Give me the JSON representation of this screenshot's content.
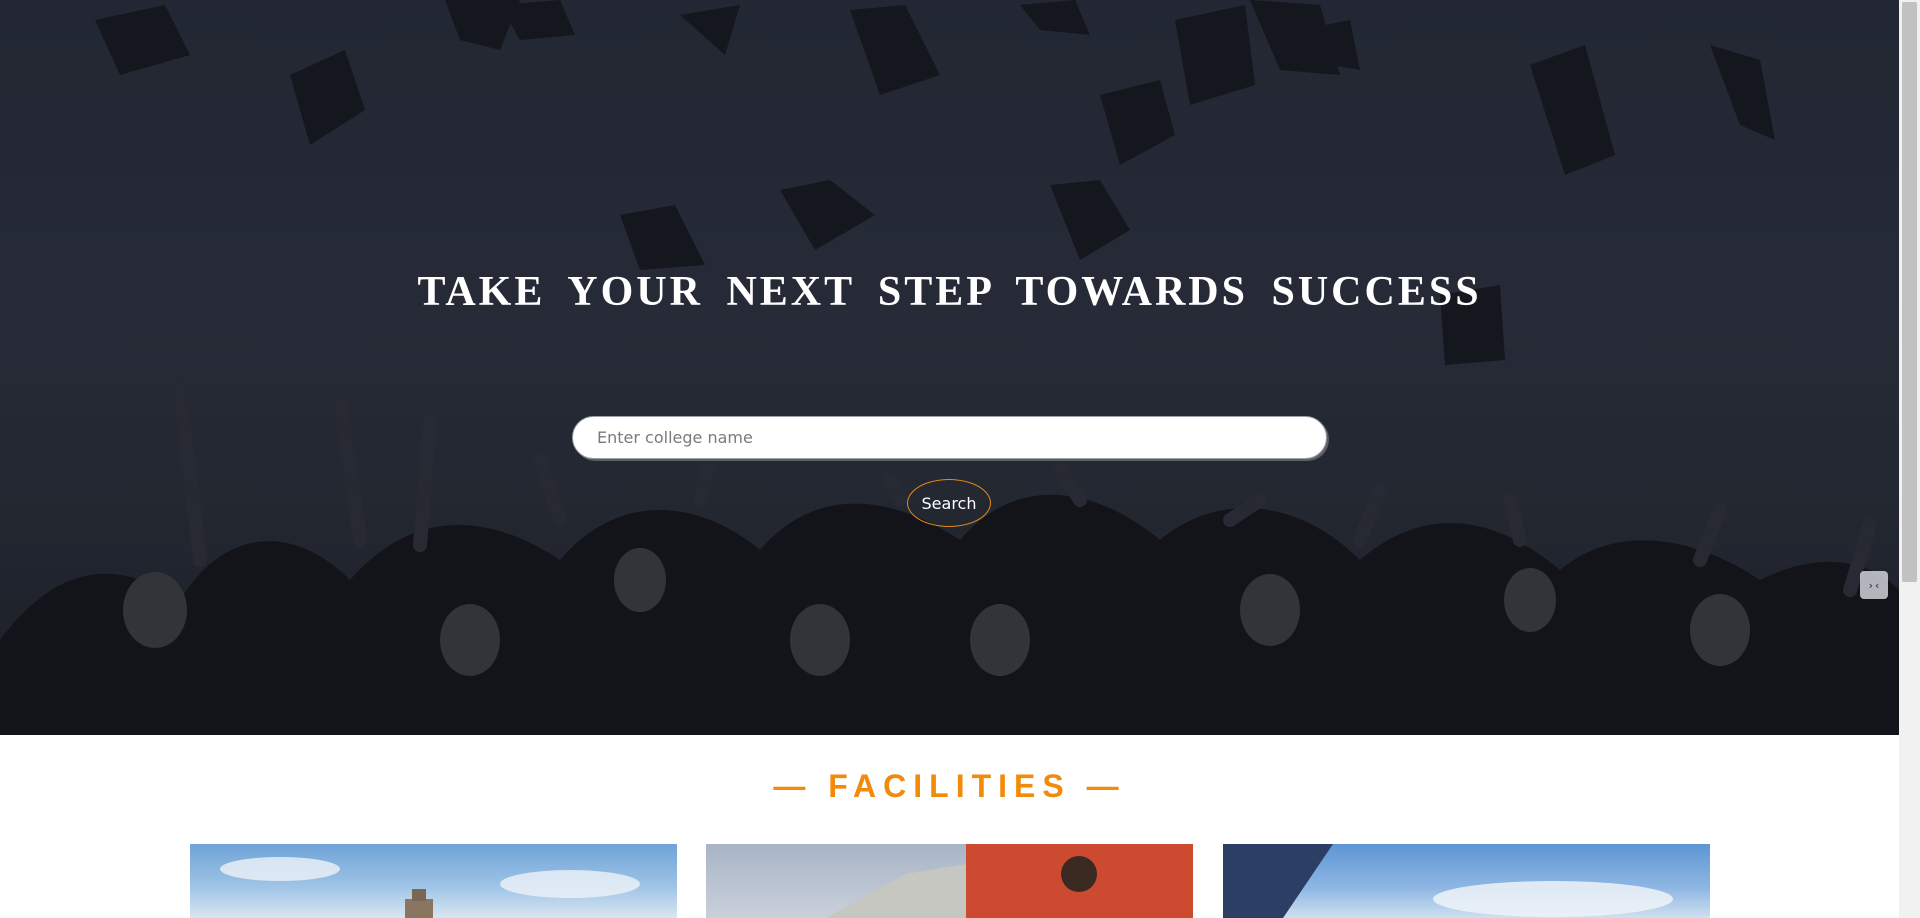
{
  "hero": {
    "title": "TAKE YOUR NEXT STEP TOWARDS SUCCESS",
    "search": {
      "placeholder": "Enter college name",
      "value": ""
    },
    "search_button_label": "Search",
    "background_image": "graduates-throwing-caps"
  },
  "facilities": {
    "heading": "— FACILITIES —",
    "cards": [
      {
        "image": "campus-building-tower"
      },
      {
        "image": "red-brick-building-emblem"
      },
      {
        "image": "glass-office-building"
      }
    ]
  },
  "colors": {
    "accent": "#f28a0c",
    "hero_bg": "#262c37",
    "title_text": "#ffffff"
  }
}
